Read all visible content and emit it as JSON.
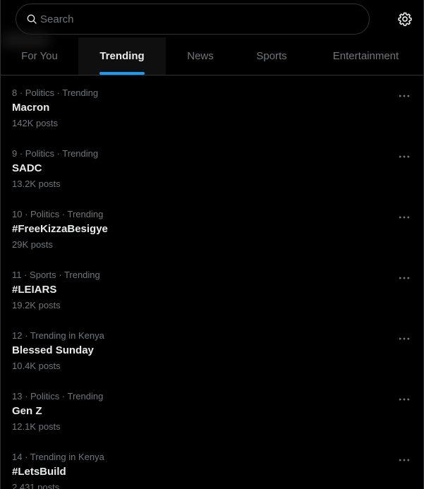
{
  "search": {
    "placeholder": "Search"
  },
  "tabs": [
    {
      "label": "For You",
      "active": false
    },
    {
      "label": "Trending",
      "active": true
    },
    {
      "label": "News",
      "active": false
    },
    {
      "label": "Sports",
      "active": false
    },
    {
      "label": "Entertainment",
      "active": false
    }
  ],
  "trends": [
    {
      "meta": "8 · Politics · Trending",
      "name": "Macron",
      "count": "142K posts"
    },
    {
      "meta": "9 · Politics · Trending",
      "name": "SADC",
      "count": "13.2K posts"
    },
    {
      "meta": "10 · Politics · Trending",
      "name": "#FreeKizzaBesigye",
      "count": "29K posts"
    },
    {
      "meta": "11 · Sports · Trending",
      "name": "#LEIARS",
      "count": "19.2K posts"
    },
    {
      "meta": "12 · Trending in Kenya",
      "name": "Blessed Sunday",
      "count": "10.4K posts"
    },
    {
      "meta": "13 · Politics · Trending",
      "name": "Gen Z",
      "count": "12.1K posts"
    },
    {
      "meta": "14 · Trending in Kenya",
      "name": "#LetsBuild",
      "count": "2,431 posts"
    }
  ],
  "icons": {
    "search": "search-icon",
    "settings": "gear-icon",
    "more": "more-horizontal-icon"
  },
  "colors": {
    "background": "#000000",
    "accent": "#1d9bf0",
    "text_primary": "#e7e9ea",
    "text_secondary": "#71767b",
    "border": "#2f3336"
  }
}
